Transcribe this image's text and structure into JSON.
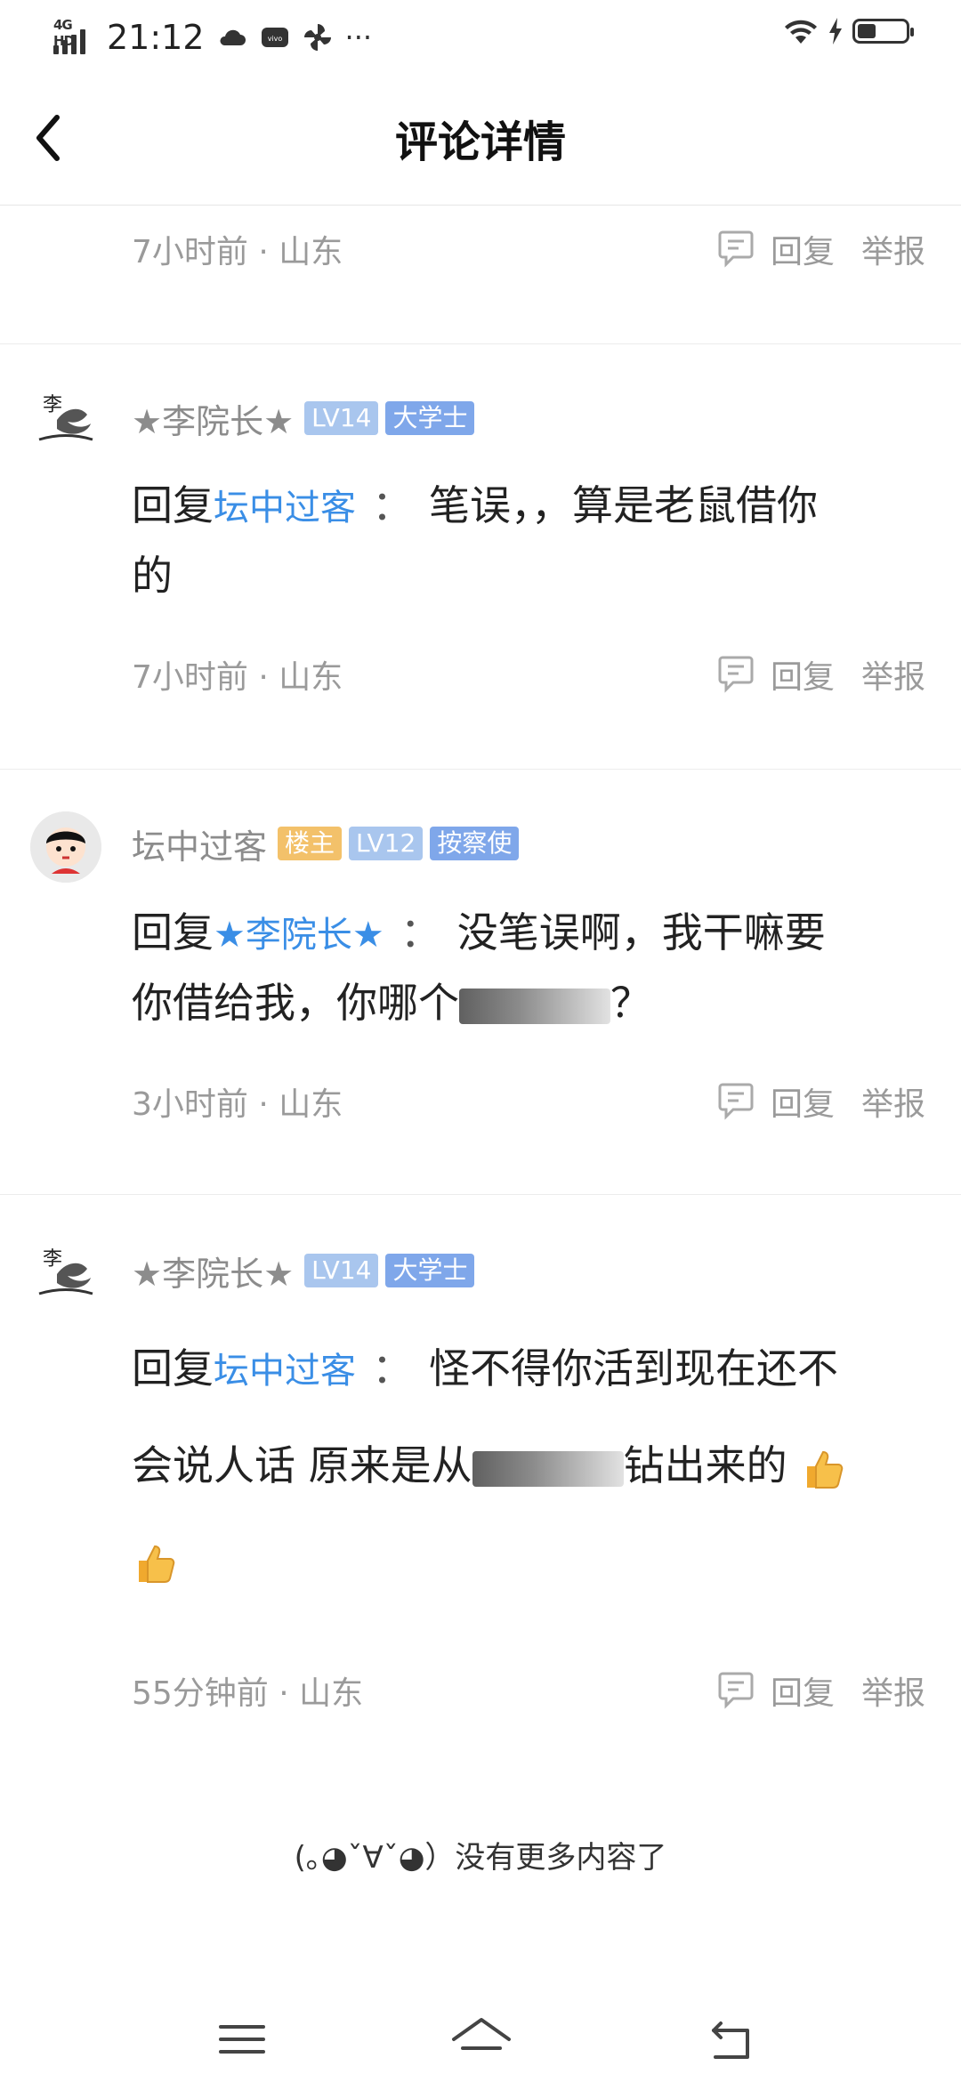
{
  "status_bar": {
    "network": "4G HD",
    "time": "21:12",
    "more_dots": "···"
  },
  "header": {
    "title": "评论详情"
  },
  "top_partial": {
    "meta": "7小时前 · 山东",
    "reply_label": "回复",
    "report_label": "举报"
  },
  "comments": [
    {
      "username": "★李院长★",
      "level": "LV14",
      "title_badge": "大学士",
      "reply_word": "回复",
      "mention": "坛中过客",
      "colon": "：",
      "text_line1": "笔误，，算是老鼠借你",
      "text_line2": "的",
      "meta": "7小时前 · 山东",
      "reply_label": "回复",
      "report_label": "举报"
    },
    {
      "username": "坛中过客",
      "owner_badge": "楼主",
      "level": "LV12",
      "title_badge": "按察使",
      "reply_word": "回复",
      "mention": "★李院长★",
      "colon": "：",
      "text_line1": "没笔误啊，我干嘛要",
      "text_line2_a": "你借给我，你哪个",
      "text_line2_b": "？",
      "meta": "3小时前 · 山东",
      "reply_label": "回复",
      "report_label": "举报"
    },
    {
      "username": "★李院长★",
      "level": "LV14",
      "title_badge": "大学士",
      "reply_word": "回复",
      "mention": "坛中过客",
      "colon": "：",
      "text_line1": "怪不得你活到现在还不",
      "text_line2_a": "会说人话 原来是从",
      "text_line2_b": "钻出来的",
      "meta": "55分钟前 · 山东",
      "reply_label": "回复",
      "report_label": "举报"
    }
  ],
  "end_tip": "(｡◕ˇ∀ˇ◕）没有更多内容了"
}
